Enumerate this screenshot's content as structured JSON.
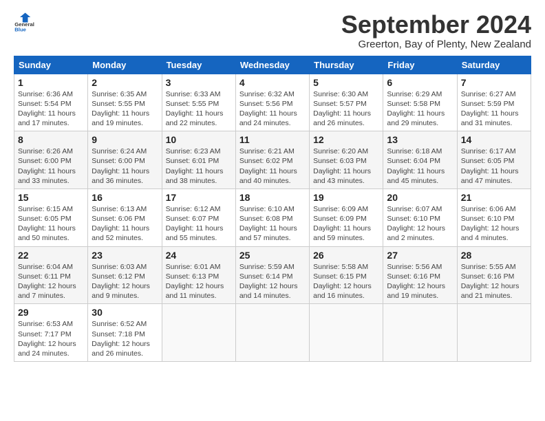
{
  "header": {
    "logo_line1": "General",
    "logo_line2": "Blue",
    "month": "September 2024",
    "location": "Greerton, Bay of Plenty, New Zealand"
  },
  "columns": [
    "Sunday",
    "Monday",
    "Tuesday",
    "Wednesday",
    "Thursday",
    "Friday",
    "Saturday"
  ],
  "weeks": [
    [
      {
        "day": "1",
        "sunrise": "Sunrise: 6:36 AM",
        "sunset": "Sunset: 5:54 PM",
        "daylight": "Daylight: 11 hours and 17 minutes."
      },
      {
        "day": "2",
        "sunrise": "Sunrise: 6:35 AM",
        "sunset": "Sunset: 5:55 PM",
        "daylight": "Daylight: 11 hours and 19 minutes."
      },
      {
        "day": "3",
        "sunrise": "Sunrise: 6:33 AM",
        "sunset": "Sunset: 5:55 PM",
        "daylight": "Daylight: 11 hours and 22 minutes."
      },
      {
        "day": "4",
        "sunrise": "Sunrise: 6:32 AM",
        "sunset": "Sunset: 5:56 PM",
        "daylight": "Daylight: 11 hours and 24 minutes."
      },
      {
        "day": "5",
        "sunrise": "Sunrise: 6:30 AM",
        "sunset": "Sunset: 5:57 PM",
        "daylight": "Daylight: 11 hours and 26 minutes."
      },
      {
        "day": "6",
        "sunrise": "Sunrise: 6:29 AM",
        "sunset": "Sunset: 5:58 PM",
        "daylight": "Daylight: 11 hours and 29 minutes."
      },
      {
        "day": "7",
        "sunrise": "Sunrise: 6:27 AM",
        "sunset": "Sunset: 5:59 PM",
        "daylight": "Daylight: 11 hours and 31 minutes."
      }
    ],
    [
      {
        "day": "8",
        "sunrise": "Sunrise: 6:26 AM",
        "sunset": "Sunset: 6:00 PM",
        "daylight": "Daylight: 11 hours and 33 minutes."
      },
      {
        "day": "9",
        "sunrise": "Sunrise: 6:24 AM",
        "sunset": "Sunset: 6:00 PM",
        "daylight": "Daylight: 11 hours and 36 minutes."
      },
      {
        "day": "10",
        "sunrise": "Sunrise: 6:23 AM",
        "sunset": "Sunset: 6:01 PM",
        "daylight": "Daylight: 11 hours and 38 minutes."
      },
      {
        "day": "11",
        "sunrise": "Sunrise: 6:21 AM",
        "sunset": "Sunset: 6:02 PM",
        "daylight": "Daylight: 11 hours and 40 minutes."
      },
      {
        "day": "12",
        "sunrise": "Sunrise: 6:20 AM",
        "sunset": "Sunset: 6:03 PM",
        "daylight": "Daylight: 11 hours and 43 minutes."
      },
      {
        "day": "13",
        "sunrise": "Sunrise: 6:18 AM",
        "sunset": "Sunset: 6:04 PM",
        "daylight": "Daylight: 11 hours and 45 minutes."
      },
      {
        "day": "14",
        "sunrise": "Sunrise: 6:17 AM",
        "sunset": "Sunset: 6:05 PM",
        "daylight": "Daylight: 11 hours and 47 minutes."
      }
    ],
    [
      {
        "day": "15",
        "sunrise": "Sunrise: 6:15 AM",
        "sunset": "Sunset: 6:05 PM",
        "daylight": "Daylight: 11 hours and 50 minutes."
      },
      {
        "day": "16",
        "sunrise": "Sunrise: 6:13 AM",
        "sunset": "Sunset: 6:06 PM",
        "daylight": "Daylight: 11 hours and 52 minutes."
      },
      {
        "day": "17",
        "sunrise": "Sunrise: 6:12 AM",
        "sunset": "Sunset: 6:07 PM",
        "daylight": "Daylight: 11 hours and 55 minutes."
      },
      {
        "day": "18",
        "sunrise": "Sunrise: 6:10 AM",
        "sunset": "Sunset: 6:08 PM",
        "daylight": "Daylight: 11 hours and 57 minutes."
      },
      {
        "day": "19",
        "sunrise": "Sunrise: 6:09 AM",
        "sunset": "Sunset: 6:09 PM",
        "daylight": "Daylight: 11 hours and 59 minutes."
      },
      {
        "day": "20",
        "sunrise": "Sunrise: 6:07 AM",
        "sunset": "Sunset: 6:10 PM",
        "daylight": "Daylight: 12 hours and 2 minutes."
      },
      {
        "day": "21",
        "sunrise": "Sunrise: 6:06 AM",
        "sunset": "Sunset: 6:10 PM",
        "daylight": "Daylight: 12 hours and 4 minutes."
      }
    ],
    [
      {
        "day": "22",
        "sunrise": "Sunrise: 6:04 AM",
        "sunset": "Sunset: 6:11 PM",
        "daylight": "Daylight: 12 hours and 7 minutes."
      },
      {
        "day": "23",
        "sunrise": "Sunrise: 6:03 AM",
        "sunset": "Sunset: 6:12 PM",
        "daylight": "Daylight: 12 hours and 9 minutes."
      },
      {
        "day": "24",
        "sunrise": "Sunrise: 6:01 AM",
        "sunset": "Sunset: 6:13 PM",
        "daylight": "Daylight: 12 hours and 11 minutes."
      },
      {
        "day": "25",
        "sunrise": "Sunrise: 5:59 AM",
        "sunset": "Sunset: 6:14 PM",
        "daylight": "Daylight: 12 hours and 14 minutes."
      },
      {
        "day": "26",
        "sunrise": "Sunrise: 5:58 AM",
        "sunset": "Sunset: 6:15 PM",
        "daylight": "Daylight: 12 hours and 16 minutes."
      },
      {
        "day": "27",
        "sunrise": "Sunrise: 5:56 AM",
        "sunset": "Sunset: 6:16 PM",
        "daylight": "Daylight: 12 hours and 19 minutes."
      },
      {
        "day": "28",
        "sunrise": "Sunrise: 5:55 AM",
        "sunset": "Sunset: 6:16 PM",
        "daylight": "Daylight: 12 hours and 21 minutes."
      }
    ],
    [
      {
        "day": "29",
        "sunrise": "Sunrise: 6:53 AM",
        "sunset": "Sunset: 7:17 PM",
        "daylight": "Daylight: 12 hours and 24 minutes."
      },
      {
        "day": "30",
        "sunrise": "Sunrise: 6:52 AM",
        "sunset": "Sunset: 7:18 PM",
        "daylight": "Daylight: 12 hours and 26 minutes."
      },
      {
        "day": "",
        "sunrise": "",
        "sunset": "",
        "daylight": ""
      },
      {
        "day": "",
        "sunrise": "",
        "sunset": "",
        "daylight": ""
      },
      {
        "day": "",
        "sunrise": "",
        "sunset": "",
        "daylight": ""
      },
      {
        "day": "",
        "sunrise": "",
        "sunset": "",
        "daylight": ""
      },
      {
        "day": "",
        "sunrise": "",
        "sunset": "",
        "daylight": ""
      }
    ]
  ]
}
